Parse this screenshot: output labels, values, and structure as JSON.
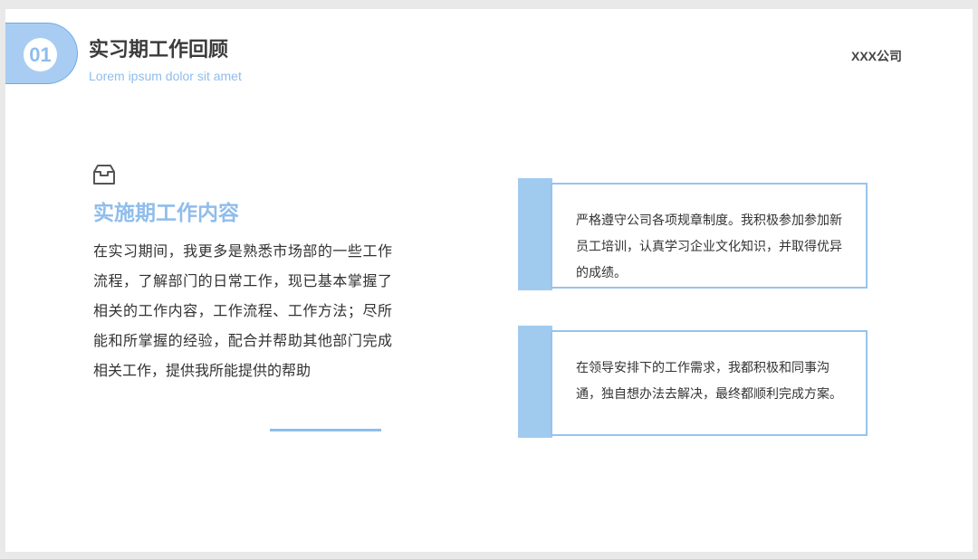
{
  "header": {
    "number": "01",
    "title": "实习期工作回顾",
    "subtitle": "Lorem ipsum dolor sit amet",
    "company": "XXX公司"
  },
  "section": {
    "icon": "inbox-icon",
    "title": "实施期工作内容",
    "body": "在实习期间，我更多是熟悉市场部的一些工作流程，了解部门的日常工作，现已基本掌握了相关的工作内容，工作流程、工作方法；尽所能和所掌握的经验，配合并帮助其他部门完成相关工作，提供我所能提供的帮助"
  },
  "cards": [
    {
      "text": "严格遵守公司各项规章制度。我积极参加参加新员工培训，认真学习企业文化知识，并取得优异的成绩。"
    },
    {
      "text": "在领导安排下的工作需求，我都积极和同事沟通，独自想办法去解决，最终都顺利完成方案。"
    }
  ],
  "colors": {
    "accent": "#8fbdec",
    "accent_light": "#a0cbef",
    "text": "#333333",
    "background": "#ffffff"
  }
}
